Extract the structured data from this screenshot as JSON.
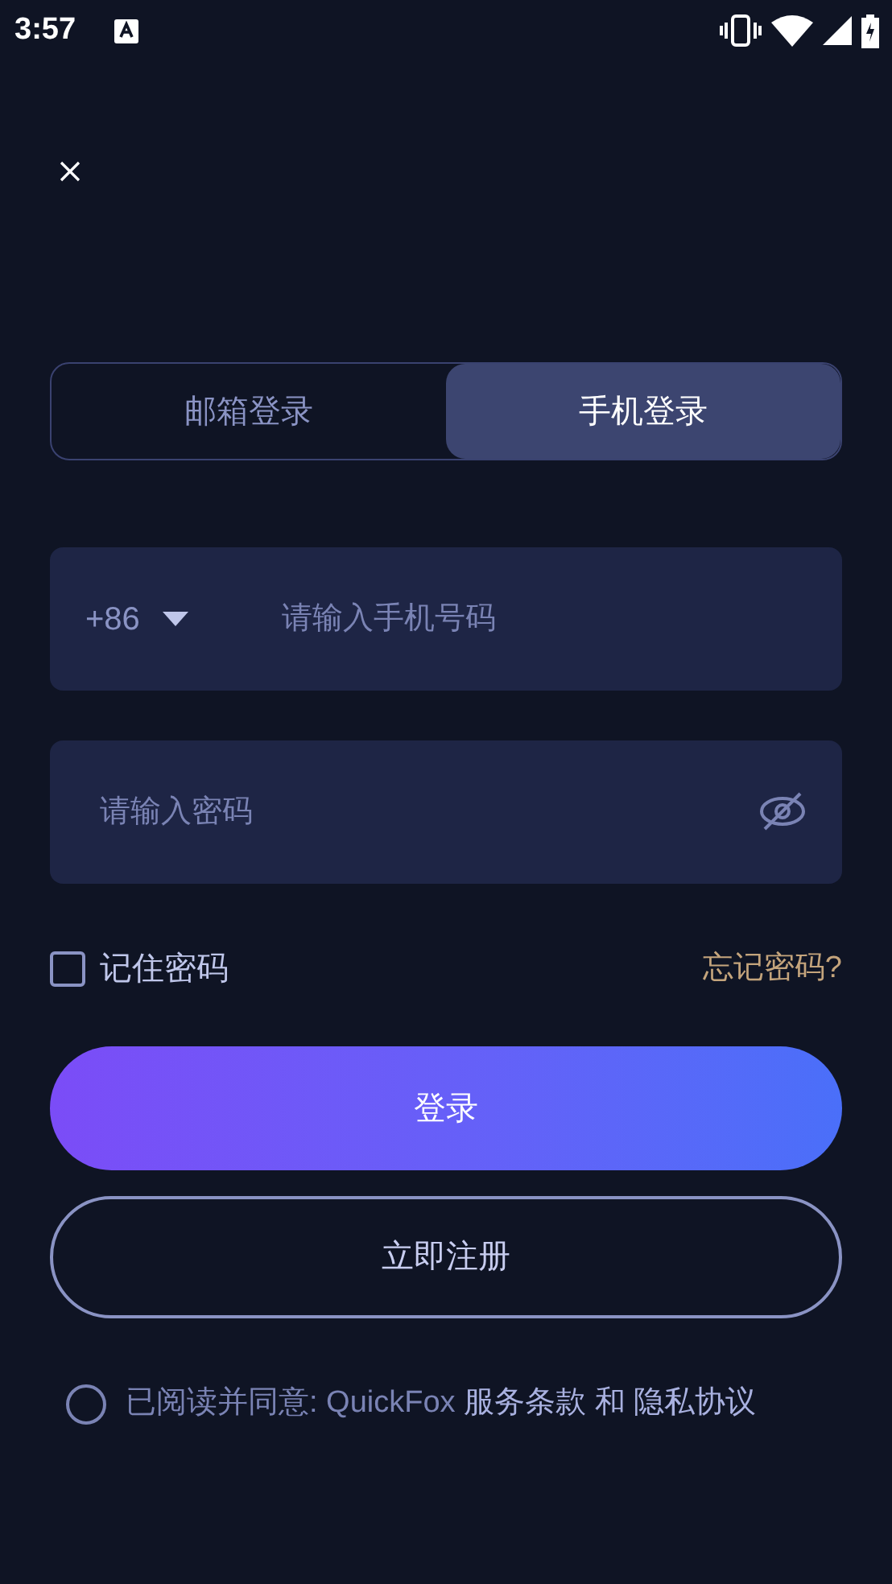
{
  "status_bar": {
    "time": "3:57"
  },
  "tabs": [
    {
      "label": "邮箱登录",
      "selected": false
    },
    {
      "label": "手机登录",
      "selected": true
    }
  ],
  "phone_field": {
    "country_code": "+86",
    "placeholder": "请输入手机号码"
  },
  "password_field": {
    "placeholder": "请输入密码"
  },
  "remember": {
    "label": "记住密码",
    "checked": false
  },
  "forgot_link": "忘记密码?",
  "login_button": "登录",
  "register_button": "立即注册",
  "agreement": {
    "checked": false,
    "prefix": "已阅读并同意: QuickFox",
    "terms": "服务条款",
    "joiner": "和",
    "privacy": "隐私协议"
  }
}
